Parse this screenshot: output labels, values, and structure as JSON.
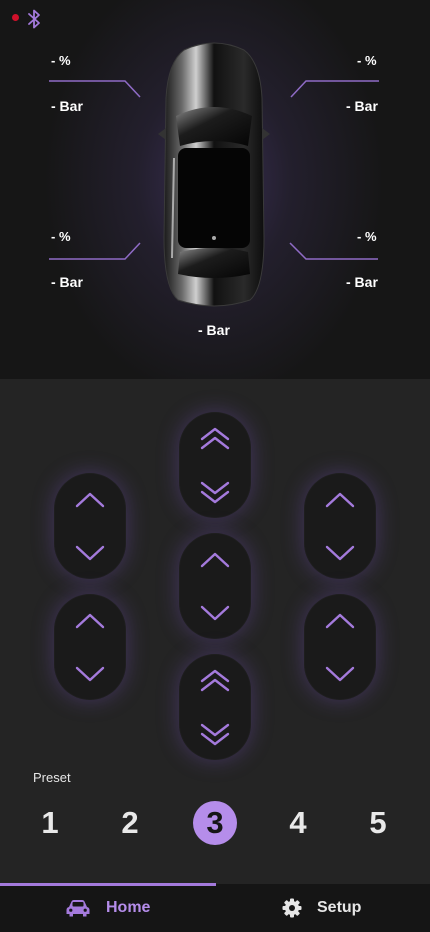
{
  "status": {
    "indicator_color": "#d0102a",
    "bluetooth_icon": "bluetooth-icon"
  },
  "tires": {
    "front_left": {
      "percent": "- %",
      "pressure": "- Bar"
    },
    "front_right": {
      "percent": "- %",
      "pressure": "- Bar"
    },
    "rear_left": {
      "percent": "- %",
      "pressure": "- Bar"
    },
    "rear_right": {
      "percent": "- %",
      "pressure": "- Bar"
    },
    "tank": {
      "pressure": "- Bar"
    }
  },
  "controls": {
    "front_left": {
      "up_icon": "chevron-up-icon",
      "down_icon": "chevron-down-icon"
    },
    "rear_left": {
      "up_icon": "chevron-up-icon",
      "down_icon": "chevron-down-icon"
    },
    "front_axle": {
      "up_icon": "double-chevron-up-icon",
      "down_icon": "double-chevron-down-icon"
    },
    "center": {
      "up_icon": "chevron-up-icon",
      "down_icon": "chevron-down-icon"
    },
    "rear_axle": {
      "up_icon": "double-chevron-up-icon",
      "down_icon": "double-chevron-down-icon"
    },
    "front_right": {
      "up_icon": "chevron-up-icon",
      "down_icon": "chevron-down-icon"
    },
    "rear_right": {
      "up_icon": "chevron-up-icon",
      "down_icon": "chevron-down-icon"
    }
  },
  "presets": {
    "label": "Preset",
    "items": [
      "1",
      "2",
      "3",
      "4",
      "5"
    ],
    "selected": "3"
  },
  "nav": {
    "home_label": "Home",
    "setup_label": "Setup",
    "active": "Home"
  },
  "colors": {
    "accent": "#b58dea",
    "accent_line": "#8f6bc6",
    "background": "#1b1b1b"
  }
}
